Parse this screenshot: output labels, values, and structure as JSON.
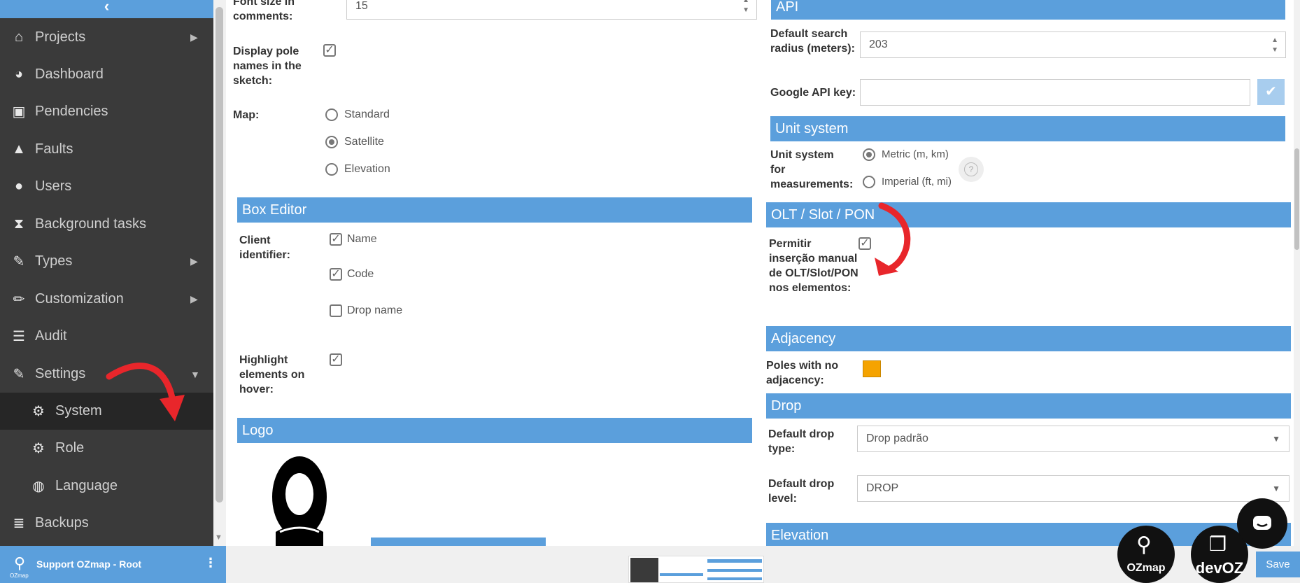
{
  "sidebar": {
    "collapse_icon": "chevron-left-icon",
    "items": [
      {
        "label": "Projects",
        "icon": "home-icon",
        "caret": "▶"
      },
      {
        "label": "Dashboard",
        "icon": "pie-chart-icon",
        "caret": ""
      },
      {
        "label": "Pendencies",
        "icon": "briefcase-clock-icon",
        "caret": ""
      },
      {
        "label": "Faults",
        "icon": "warning-icon",
        "caret": ""
      },
      {
        "label": "Users",
        "icon": "user-icon",
        "caret": ""
      },
      {
        "label": "Background tasks",
        "icon": "hourglass-icon",
        "caret": ""
      },
      {
        "label": "Types",
        "icon": "wrench-icon",
        "caret": "▶"
      },
      {
        "label": "Customization",
        "icon": "pencil-icon",
        "caret": "▶"
      },
      {
        "label": "Audit",
        "icon": "list-icon",
        "caret": ""
      },
      {
        "label": "Settings",
        "icon": "wrench-icon",
        "caret": "▼"
      }
    ],
    "sub_items": [
      {
        "label": "System",
        "icon": "gear-icon"
      },
      {
        "label": "Role",
        "icon": "gear-icon"
      },
      {
        "label": "Language",
        "icon": "globe-icon"
      }
    ],
    "backups": {
      "label": "Backups",
      "icon": "database-icon"
    },
    "footer": {
      "user": "Support OZmap - Root",
      "logo_text": "OZmap"
    }
  },
  "left": {
    "font_size_label": "Font size in comments:",
    "font_size_value": "15",
    "pole_names_label": "Display pole names in the sketch:",
    "pole_names_checked": true,
    "map_label": "Map:",
    "map_options": [
      "Standard",
      "Satellite",
      "Elevation"
    ],
    "map_selected": "Satellite",
    "box_editor_title": "Box Editor",
    "client_identifier_label": "Client identifier:",
    "client_options": [
      {
        "label": "Name",
        "checked": true
      },
      {
        "label": "Code",
        "checked": true
      },
      {
        "label": "Drop name",
        "checked": false
      }
    ],
    "highlight_label": "Highlight elements on hover:",
    "highlight_checked": true,
    "logo_title": "Logo"
  },
  "right": {
    "api_title": "API",
    "search_radius_label": "Default search radius (meters):",
    "search_radius_value": "203",
    "google_api_label": "Google API key:",
    "google_api_value": "",
    "unit_title": "Unit system",
    "unit_label": "Unit system for measurements:",
    "unit_options": [
      "Metric (m, km)",
      "Imperial (ft, mi)"
    ],
    "unit_selected": "Metric (m, km)",
    "help_icon": "?",
    "olt_title": "OLT / Slot / PON",
    "olt_label": "Permitir inserção manual de OLT/Slot/PON nos elementos:",
    "olt_checked": true,
    "adjacency_title": "Adjacency",
    "adjacency_label": "Poles with no adjacency:",
    "adjacency_color": "#f5a300",
    "drop_title": "Drop",
    "drop_type_label": "Default drop type:",
    "drop_type_value": "Drop padrão",
    "drop_level_label": "Default drop level:",
    "drop_level_value": "DROP",
    "elevation_title": "Elevation"
  },
  "footer": {
    "save_label": "Save",
    "badge_ozmap": "OZmap",
    "badge_devoz": "devOZ"
  },
  "colors": {
    "accent": "#5b9fdc",
    "sidebar": "#3a3a3a",
    "arrow": "#e8262b"
  }
}
